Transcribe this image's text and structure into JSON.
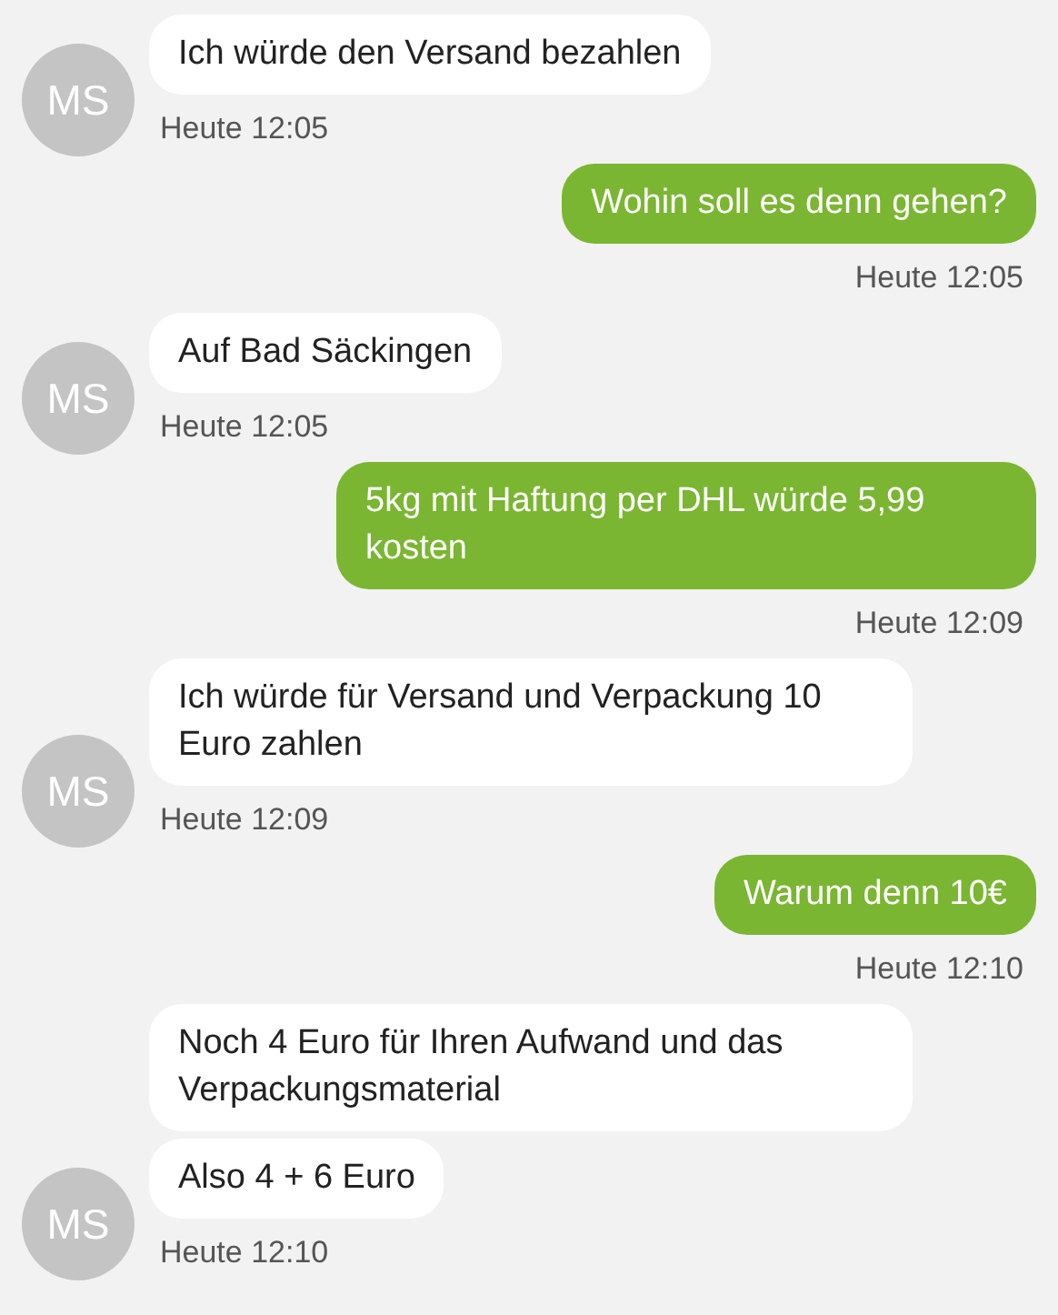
{
  "messages": [
    {
      "kind": "incoming",
      "initials": "MS",
      "bubbles": [
        "Ich würde den Versand bezahlen"
      ],
      "time": "Heute 12:05"
    },
    {
      "kind": "outgoing",
      "bubbles": [
        "Wohin soll es denn gehen?"
      ],
      "time": "Heute 12:05"
    },
    {
      "kind": "incoming",
      "initials": "MS",
      "bubbles": [
        "Auf Bad Säckingen"
      ],
      "time": "Heute 12:05"
    },
    {
      "kind": "outgoing",
      "bubbles": [
        "5kg mit Haftung per DHL würde 5,99 kosten"
      ],
      "time": "Heute 12:09"
    },
    {
      "kind": "incoming",
      "initials": "MS",
      "bubbles": [
        "Ich würde für Versand und Verpackung 10 Euro zahlen"
      ],
      "time": "Heute 12:09"
    },
    {
      "kind": "outgoing",
      "bubbles": [
        "Warum denn 10€"
      ],
      "time": "Heute 12:10"
    },
    {
      "kind": "incoming",
      "initials": "MS",
      "bubbles": [
        "Noch 4 Euro für Ihren Aufwand und das Verpackungsmaterial",
        "Also 4 + 6 Euro"
      ],
      "time": "Heute 12:10"
    }
  ]
}
